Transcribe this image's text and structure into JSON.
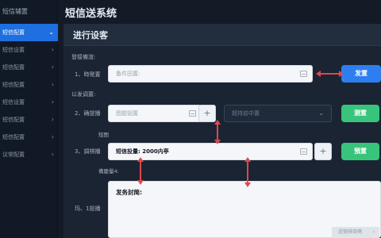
{
  "sidebar": {
    "header": "短信辅置",
    "items": [
      {
        "label": "短信配置",
        "active": true
      },
      {
        "label": "短信设置",
        "active": false
      },
      {
        "label": "短信配置",
        "active": false
      },
      {
        "label": "短信配置",
        "active": false
      },
      {
        "label": "短信设置",
        "active": false
      },
      {
        "label": "短信配置",
        "active": false
      },
      {
        "label": "短信配置",
        "active": false
      },
      {
        "label": "议常配置",
        "active": false
      }
    ]
  },
  "app": {
    "title": "短信送系统"
  },
  "panel": {
    "title": "进行设客",
    "section1_label": "發接備渲:",
    "row1": {
      "label": "1、時発置",
      "placeholder": "备件田置:",
      "button": "发置"
    },
    "section2_label": "以发调置:",
    "row2": {
      "label": "2、确提播",
      "placeholder": "图题钼置",
      "select_placeholder": "超持前中置",
      "button": "测置"
    },
    "row3": {
      "sublabel": "短图",
      "label": "3、調棋播",
      "value": "短信投量: 2000内亭",
      "button": "預置"
    },
    "row4": {
      "sublabel": "備慶量4:",
      "label": "玛、1投播",
      "textarea_value": "发务封简:"
    },
    "footer_button": "适钢排商萌"
  }
}
